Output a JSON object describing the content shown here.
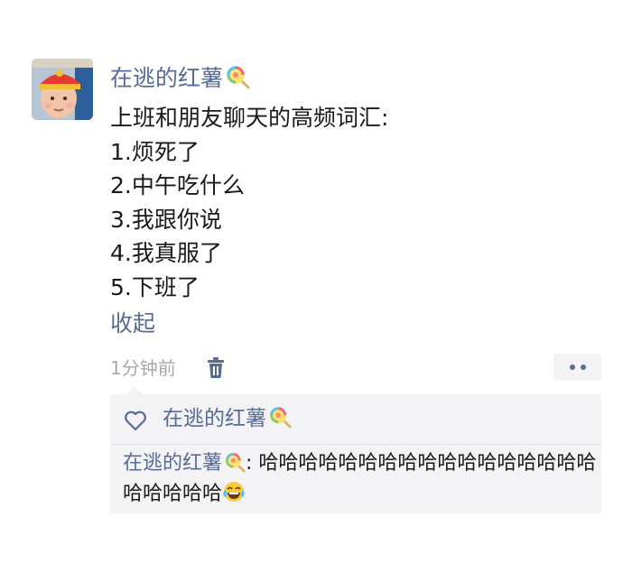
{
  "post": {
    "author": "在逃的红薯",
    "author_icon": "lollipop-icon",
    "lines": [
      "上班和朋友聊天的高频词汇:",
      "1.烦死了",
      "2.中午吃什么",
      "3.我跟你说",
      "4.我真服了",
      "5.下班了"
    ],
    "collapse_label": "收起",
    "timestamp": "1分钟前",
    "delete_icon": "trash-icon",
    "more_icon": "more-dots-icon"
  },
  "likes": {
    "icon": "heart-outline-icon",
    "names": [
      "在逃的红薯"
    ]
  },
  "comments": [
    {
      "author": "在逃的红薯",
      "separator": ": ",
      "text": "哈哈哈哈哈哈哈哈哈哈哈哈哈哈哈哈哈哈哈哈哈哈",
      "emoji": "tears-of-joy-emoji"
    }
  ],
  "colors": {
    "link": "#576b95",
    "text": "#1a1a1a",
    "meta": "#a8a8a8",
    "panel": "#f3f3f5"
  }
}
